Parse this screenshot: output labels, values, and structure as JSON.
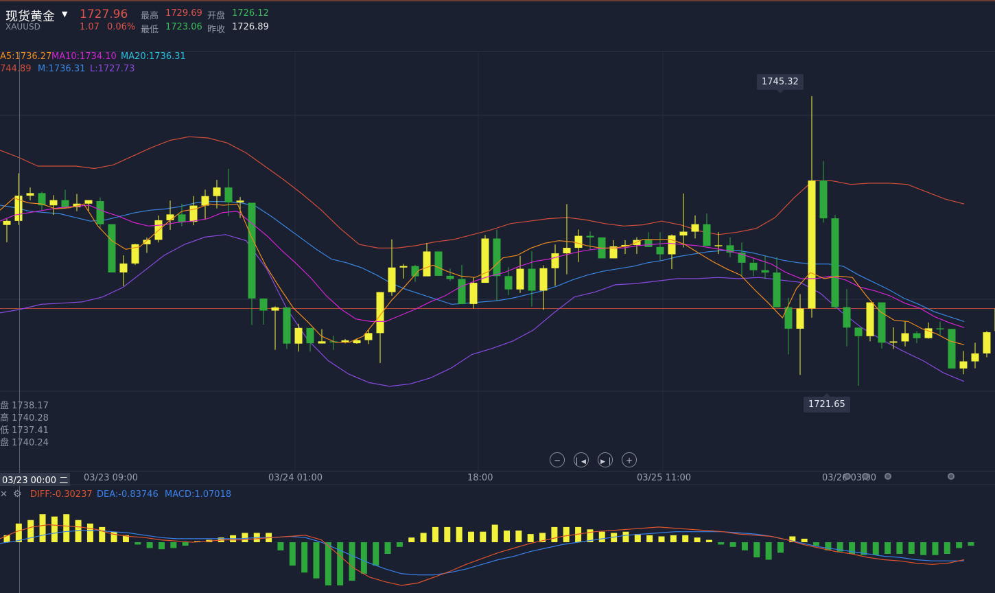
{
  "header": {
    "title": "现货黄金",
    "symbol": "XAUUSD",
    "price": "1727.96",
    "change": "1.07",
    "change_pct": "0.06%",
    "high_label": "最高",
    "high_value": "1729.69",
    "open_label": "开盘",
    "open_value": "1726.12",
    "low_label": "最低",
    "low_value": "1723.06",
    "prev_close_label": "昨收",
    "prev_close_value": "1726.89"
  },
  "ma_legend": {
    "ma5": "A5:1736.27",
    "ma10": "MA10:1734.10",
    "ma20": "MA20:1736.31"
  },
  "boll_legend": {
    "upper": "744.89",
    "mid": "M:1736.31",
    "lower": "L:1727.73"
  },
  "cursor_ohlc": [
    "盘 1738.17",
    "高 1740.28",
    "低 1737.41",
    "盘 1740.24"
  ],
  "markers": {
    "high": "1745.32",
    "low": "1721.65"
  },
  "time_axis": {
    "cursor_label": "03/23 00:00 二",
    "ticks": [
      "03/23 09:00",
      "03/24 01:00",
      "18:00",
      "03/25 11:00",
      "03/26 03:00"
    ]
  },
  "macd_legend": {
    "diff": "DIFF:-0.30237",
    "dea": "DEA:-0.83746",
    "macd": "MACD:1.07018"
  },
  "controls": [
    "zoom-out",
    "prev",
    "next",
    "zoom-in"
  ],
  "colors": {
    "bg": "#1a2030",
    "up_candle": "#f2f23c",
    "down_candle": "#2ea83c",
    "ma5": "#f08c1e",
    "ma10": "#d424d4",
    "ma20": "#2aa0e6",
    "boll_upper": "#d24e3a",
    "boll_mid": "#3a86e0",
    "boll_lower": "#8a4ae0",
    "diff": "#e0532c",
    "dea": "#3a80e8"
  },
  "chart_data": {
    "type": "candlestick",
    "ylim": [
      1719.5,
      1748.5
    ],
    "candles": [
      {
        "o": 1734.79,
        "h": 1735.27,
        "l": 1733.38,
        "c": 1735.12
      },
      {
        "o": 1735.12,
        "h": 1739.01,
        "l": 1734.79,
        "c": 1737.18
      },
      {
        "o": 1737.18,
        "h": 1737.85,
        "l": 1736.8,
        "c": 1737.39
      },
      {
        "o": 1737.39,
        "h": 1737.5,
        "l": 1735.96,
        "c": 1736.39
      },
      {
        "o": 1736.39,
        "h": 1737.22,
        "l": 1735.61,
        "c": 1736.82
      },
      {
        "o": 1736.82,
        "h": 1737.67,
        "l": 1736.14,
        "c": 1736.24
      },
      {
        "o": 1736.24,
        "h": 1737.33,
        "l": 1735.92,
        "c": 1736.53
      },
      {
        "o": 1736.53,
        "h": 1736.82,
        "l": 1735.92,
        "c": 1736.82
      },
      {
        "o": 1736.74,
        "h": 1737.04,
        "l": 1734.51,
        "c": 1734.85
      },
      {
        "o": 1734.85,
        "h": 1734.85,
        "l": 1730.91,
        "c": 1730.91
      },
      {
        "o": 1730.91,
        "h": 1732.31,
        "l": 1729.79,
        "c": 1731.64
      },
      {
        "o": 1731.64,
        "h": 1733.25,
        "l": 1731.53,
        "c": 1733.21
      },
      {
        "o": 1733.21,
        "h": 1733.76,
        "l": 1732.51,
        "c": 1733.57
      },
      {
        "o": 1733.57,
        "h": 1735.56,
        "l": 1733.36,
        "c": 1735.17
      },
      {
        "o": 1735.17,
        "h": 1736.78,
        "l": 1734.38,
        "c": 1735.65
      },
      {
        "o": 1735.65,
        "h": 1736.53,
        "l": 1734.69,
        "c": 1735.05
      },
      {
        "o": 1735.05,
        "h": 1737.15,
        "l": 1734.77,
        "c": 1736.37
      },
      {
        "o": 1736.37,
        "h": 1737.67,
        "l": 1735.22,
        "c": 1737.15
      },
      {
        "o": 1737.15,
        "h": 1738.47,
        "l": 1736.14,
        "c": 1737.85
      },
      {
        "o": 1737.85,
        "h": 1739.38,
        "l": 1735.51,
        "c": 1736.64
      },
      {
        "o": 1736.64,
        "h": 1737.07,
        "l": 1735.36,
        "c": 1736.78
      },
      {
        "o": 1736.6,
        "h": 1736.6,
        "l": 1726.61,
        "c": 1728.78
      },
      {
        "o": 1728.78,
        "h": 1728.78,
        "l": 1726.64,
        "c": 1727.79
      },
      {
        "o": 1727.79,
        "h": 1728.14,
        "l": 1724.58,
        "c": 1728.05
      },
      {
        "o": 1728.05,
        "h": 1728.05,
        "l": 1724.65,
        "c": 1725.09
      },
      {
        "o": 1725.09,
        "h": 1726.71,
        "l": 1724.44,
        "c": 1726.37
      },
      {
        "o": 1726.37,
        "h": 1726.37,
        "l": 1724.44,
        "c": 1725.12
      },
      {
        "o": 1725.1,
        "h": 1726.27,
        "l": 1725.1,
        "c": 1725.28
      },
      {
        "o": 1725.28,
        "h": 1725.73,
        "l": 1724.58,
        "c": 1725.21
      },
      {
        "o": 1725.21,
        "h": 1725.47,
        "l": 1725.11,
        "c": 1725.36
      },
      {
        "o": 1725.12,
        "h": 1725.53,
        "l": 1725.07,
        "c": 1725.38
      },
      {
        "o": 1725.38,
        "h": 1726.27,
        "l": 1725.06,
        "c": 1725.95
      },
      {
        "o": 1725.95,
        "h": 1728.43,
        "l": 1723.51,
        "c": 1729.3
      },
      {
        "o": 1729.3,
        "h": 1733.61,
        "l": 1729.0,
        "c": 1731.31
      },
      {
        "o": 1731.31,
        "h": 1731.6,
        "l": 1730.41,
        "c": 1731.43
      },
      {
        "o": 1731.43,
        "h": 1731.53,
        "l": 1730.14,
        "c": 1730.59
      },
      {
        "o": 1730.59,
        "h": 1733.31,
        "l": 1730.63,
        "c": 1732.62
      },
      {
        "o": 1732.62,
        "h": 1732.62,
        "l": 1730.64,
        "c": 1730.63
      },
      {
        "o": 1730.63,
        "h": 1731.21,
        "l": 1730.21,
        "c": 1730.37
      },
      {
        "o": 1730.37,
        "h": 1731.53,
        "l": 1728.98,
        "c": 1728.33
      },
      {
        "o": 1728.33,
        "h": 1730.5,
        "l": 1727.96,
        "c": 1730.06
      },
      {
        "o": 1730.06,
        "h": 1733.96,
        "l": 1730.06,
        "c": 1733.68
      },
      {
        "o": 1733.68,
        "h": 1734.41,
        "l": 1728.57,
        "c": 1730.61
      },
      {
        "o": 1730.61,
        "h": 1731.34,
        "l": 1729.06,
        "c": 1729.52
      },
      {
        "o": 1729.52,
        "h": 1732.26,
        "l": 1729.23,
        "c": 1731.21
      },
      {
        "o": 1731.21,
        "h": 1732.66,
        "l": 1728.13,
        "c": 1729.42
      },
      {
        "o": 1729.42,
        "h": 1731.49,
        "l": 1727.84,
        "c": 1731.25
      },
      {
        "o": 1731.25,
        "h": 1733.19,
        "l": 1729.82,
        "c": 1732.47
      },
      {
        "o": 1732.47,
        "h": 1736.49,
        "l": 1730.76,
        "c": 1732.92
      },
      {
        "o": 1732.92,
        "h": 1734.42,
        "l": 1731.76,
        "c": 1733.9
      },
      {
        "o": 1733.9,
        "h": 1734.26,
        "l": 1732.77,
        "c": 1733.77
      },
      {
        "o": 1733.77,
        "h": 1733.77,
        "l": 1732.06,
        "c": 1732.06
      },
      {
        "o": 1732.06,
        "h": 1733.55,
        "l": 1732.06,
        "c": 1733.04
      },
      {
        "o": 1733.04,
        "h": 1733.55,
        "l": 1732.41,
        "c": 1733.15
      },
      {
        "o": 1733.15,
        "h": 1733.78,
        "l": 1732.42,
        "c": 1733.56
      },
      {
        "o": 1733.56,
        "h": 1734.19,
        "l": 1732.99,
        "c": 1732.99
      },
      {
        "o": 1732.99,
        "h": 1734.19,
        "l": 1731.91,
        "c": 1732.39
      },
      {
        "o": 1732.39,
        "h": 1734.01,
        "l": 1731.18,
        "c": 1733.93
      },
      {
        "o": 1733.93,
        "h": 1737.36,
        "l": 1732.95,
        "c": 1734.24
      },
      {
        "o": 1734.24,
        "h": 1735.57,
        "l": 1733.69,
        "c": 1734.85
      },
      {
        "o": 1734.85,
        "h": 1735.72,
        "l": 1733.86,
        "c": 1733.07
      },
      {
        "o": 1733.07,
        "h": 1734.21,
        "l": 1732.41,
        "c": 1733.13
      },
      {
        "o": 1733.13,
        "h": 1733.77,
        "l": 1732.15,
        "c": 1732.53
      },
      {
        "o": 1732.53,
        "h": 1733.35,
        "l": 1730.6,
        "c": 1731.7
      },
      {
        "o": 1731.7,
        "h": 1732.08,
        "l": 1730.6,
        "c": 1731.09
      },
      {
        "o": 1731.09,
        "h": 1732.26,
        "l": 1730.36,
        "c": 1730.9
      },
      {
        "o": 1730.9,
        "h": 1732.15,
        "l": 1728.33,
        "c": 1728.06
      },
      {
        "o": 1728.06,
        "h": 1728.84,
        "l": 1724.21,
        "c": 1726.31
      },
      {
        "o": 1726.31,
        "h": 1729.14,
        "l": 1722.53,
        "c": 1727.96
      },
      {
        "o": 1727.96,
        "h": 1745.32,
        "l": 1727.22,
        "c": 1738.42
      },
      {
        "o": 1738.42,
        "h": 1740.01,
        "l": 1734.98,
        "c": 1735.33
      },
      {
        "o": 1735.33,
        "h": 1735.6,
        "l": 1727.96,
        "c": 1728.07
      },
      {
        "o": 1728.07,
        "h": 1729.54,
        "l": 1724.87,
        "c": 1726.4
      },
      {
        "o": 1726.4,
        "h": 1726.4,
        "l": 1721.65,
        "c": 1725.7
      },
      {
        "o": 1725.7,
        "h": 1728.42,
        "l": 1725.28,
        "c": 1728.46
      },
      {
        "o": 1728.46,
        "h": 1728.46,
        "l": 1724.69,
        "c": 1725.17
      },
      {
        "o": 1725.17,
        "h": 1726.42,
        "l": 1724.65,
        "c": 1725.27
      },
      {
        "o": 1725.27,
        "h": 1726.94,
        "l": 1724.87,
        "c": 1725.94
      },
      {
        "o": 1725.94,
        "h": 1726.11,
        "l": 1725.13,
        "c": 1725.54
      },
      {
        "o": 1725.54,
        "h": 1726.82,
        "l": 1725.49,
        "c": 1726.34
      },
      {
        "o": 1726.34,
        "h": 1726.89,
        "l": 1725.77,
        "c": 1726.29
      },
      {
        "o": 1726.29,
        "h": 1726.29,
        "l": 1723.06,
        "c": 1723.06
      },
      {
        "o": 1723.06,
        "h": 1724.48,
        "l": 1722.59,
        "c": 1723.64
      },
      {
        "o": 1723.64,
        "h": 1725.16,
        "l": 1723.07,
        "c": 1724.29
      },
      {
        "o": 1724.29,
        "h": 1726.12,
        "l": 1723.98,
        "c": 1726.02
      },
      {
        "o": 1726.12,
        "h": 1729.69,
        "l": 1725.45,
        "c": 1727.96
      }
    ],
    "ma5": [
      1736.0,
      1737.0,
      1736.6,
      1736.5,
      1736.1,
      1736.2,
      1736.5,
      1734.7,
      1733.5,
      1732.8,
      1733.0,
      1734.0,
      1735.0,
      1735.9,
      1736.1,
      1736.5,
      1736.4,
      1736.5,
      1733.8,
      1731.5,
      1729.7,
      1728.0,
      1726.9,
      1725.7,
      1725.2,
      1725.2,
      1725.7,
      1727.1,
      1728.6,
      1729.8,
      1731.1,
      1731.5,
      1731.0,
      1730.6,
      1730.5,
      1731.0,
      1732.1,
      1732.3,
      1732.9,
      1733.3,
      1733.5,
      1733.4,
      1733.1,
      1732.9,
      1732.9,
      1733.1,
      1733.6,
      1733.6,
      1733.6,
      1733.2,
      1732.5,
      1731.8,
      1731.2,
      1730.7,
      1729.5,
      1728.4,
      1727.2,
      1729.6,
      1730.9,
      1730.4,
      1730.6,
      1730.5,
      1729.0,
      1727.7,
      1727.0,
      1726.9,
      1726.3,
      1725.9,
      1725.3,
      1725.0
    ],
    "ma10": [
      1735.1,
      1735.6,
      1735.8,
      1736.0,
      1736.2,
      1736.3,
      1736.4,
      1735.9,
      1735.5,
      1735.0,
      1734.7,
      1734.8,
      1735.0,
      1735.1,
      1735.3,
      1735.8,
      1735.9,
      1734.9,
      1733.9,
      1732.7,
      1731.6,
      1730.4,
      1729.0,
      1727.9,
      1727.1,
      1726.9,
      1726.9,
      1727.4,
      1727.9,
      1728.5,
      1729.0,
      1729.7,
      1730.2,
      1730.6,
      1730.9,
      1731.4,
      1731.8,
      1732.0,
      1732.3,
      1732.6,
      1732.8,
      1732.9,
      1732.9,
      1733.1,
      1733.2,
      1733.3,
      1733.2,
      1733.1,
      1732.9,
      1732.7,
      1732.4,
      1732.0,
      1731.6,
      1730.9,
      1730.4,
      1730.4,
      1730.6,
      1730.3,
      1729.7,
      1729.4,
      1729.0,
      1728.4,
      1728.0,
      1727.3,
      1726.8,
      1726.4
    ],
    "boll_mid": [
      1736.4,
      1736.2,
      1735.9,
      1735.8,
      1735.7,
      1735.4,
      1735.1,
      1735.2,
      1735.5,
      1735.8,
      1736.0,
      1736.1,
      1736.3,
      1736.6,
      1736.7,
      1736.7,
      1736.6,
      1736.3,
      1735.5,
      1734.6,
      1733.7,
      1732.8,
      1732.0,
      1731.7,
      1731.3,
      1730.7,
      1730.0,
      1729.5,
      1729.1,
      1728.7,
      1728.3,
      1728.4,
      1728.5,
      1728.6,
      1728.8,
      1729.1,
      1729.4,
      1729.8,
      1730.3,
      1730.7,
      1731.0,
      1731.2,
      1731.4,
      1731.7,
      1731.9,
      1732.2,
      1732.4,
      1732.6,
      1732.7,
      1732.7,
      1732.5,
      1732.2,
      1731.9,
      1731.7,
      1731.6,
      1731.6,
      1731.4,
      1730.7,
      1730.1,
      1729.5,
      1728.8,
      1728.3,
      1727.7,
      1727.3,
      1726.9
    ],
    "boll_upper": [
      1740.9,
      1740.3,
      1739.6,
      1739.6,
      1739.6,
      1739.4,
      1739.7,
      1740.4,
      1741.1,
      1741.7,
      1742.0,
      1741.9,
      1741.5,
      1740.7,
      1739.6,
      1738.5,
      1737.3,
      1736.0,
      1734.5,
      1733.2,
      1732.9,
      1732.9,
      1733.1,
      1733.4,
      1733.6,
      1734.0,
      1734.4,
      1734.9,
      1735.1,
      1735.3,
      1735.4,
      1735.2,
      1734.9,
      1734.7,
      1734.8,
      1735.1,
      1734.8,
      1734.3,
      1734.0,
      1734.2,
      1734.5,
      1735.4,
      1737.0,
      1738.4,
      1738.4,
      1738.1,
      1738.2,
      1738.2,
      1738.1,
      1737.5,
      1736.9,
      1736.5
    ],
    "boll_lower": [
      1727.6,
      1727.9,
      1728.3,
      1728.4,
      1728.5,
      1728.9,
      1729.7,
      1731.0,
      1732.3,
      1733.2,
      1733.8,
      1734.0,
      1733.5,
      1731.2,
      1727.9,
      1725.4,
      1723.7,
      1722.6,
      1721.9,
      1721.6,
      1721.8,
      1722.3,
      1723.1,
      1724.2,
      1724.7,
      1725.3,
      1726.2,
      1727.6,
      1728.9,
      1729.3,
      1729.9,
      1730.0,
      1730.2,
      1730.4,
      1730.4,
      1730.5,
      1730.4,
      1730.5,
      1730.3,
      1730.1,
      1729.2,
      1727.7,
      1726.4,
      1725.4,
      1724.5,
      1723.7,
      1722.7,
      1722.0
    ],
    "macd_hist": [
      0.6,
      1.6,
      1.9,
      2.4,
      2.2,
      2.4,
      1.9,
      1.6,
      1.3,
      0.9,
      0.6,
      -0.2,
      -0.5,
      -0.6,
      -0.5,
      -0.3,
      0.1,
      0.2,
      0.4,
      0.6,
      0.8,
      0.8,
      0.8,
      -0.7,
      -2.0,
      -2.6,
      -3.1,
      -3.7,
      -3.7,
      -3.3,
      -2.7,
      -2.0,
      -1.0,
      -0.4,
      0.4,
      0.8,
      1.3,
      1.3,
      1.3,
      0.9,
      0.9,
      1.5,
      1.0,
      1.0,
      0.7,
      0.8,
      1.3,
      1.3,
      1.3,
      1.1,
      0.9,
      0.8,
      0.9,
      0.7,
      0.6,
      0.5,
      0.6,
      0.6,
      0.4,
      0.2,
      -0.2,
      -0.4,
      -0.7,
      -1.3,
      -1.5,
      -0.9,
      0.5,
      0.3,
      -0.3,
      -0.7,
      -0.8,
      -1.0,
      -1.1,
      -1.1,
      -1.0,
      -1.0,
      -1.0,
      -1.1,
      -1.1,
      -1.0,
      -0.5,
      -0.3
    ],
    "macd_diff": [
      0.3,
      0.9,
      1.3,
      1.5,
      1.4,
      1.3,
      1.1,
      0.7,
      0.5,
      0.4,
      0.2,
      0.1,
      0.0,
      0.1,
      0.2,
      0.2,
      0.3,
      0.4,
      0.5,
      0.6,
      0.2,
      -1.0,
      -2.2,
      -3.0,
      -3.4,
      -3.7,
      -3.5,
      -3.0,
      -2.5,
      -1.9,
      -1.4,
      -0.9,
      -0.5,
      -0.1,
      0.2,
      0.5,
      0.7,
      0.9,
      1.0,
      1.1,
      1.2,
      1.3,
      1.2,
      1.1,
      1.0,
      0.9,
      0.7,
      0.6,
      0.5,
      0.2,
      -0.2,
      -0.5,
      -0.8,
      -1.0,
      -1.3,
      -1.5,
      -1.6,
      -1.8,
      -1.9,
      -1.8,
      -1.5
    ],
    "macd_dea": [
      -0.1,
      0.1,
      0.4,
      0.7,
      0.9,
      1.0,
      1.0,
      0.9,
      0.8,
      0.6,
      0.4,
      0.3,
      0.3,
      0.3,
      0.3,
      0.3,
      0.4,
      0.4,
      0.5,
      0.4,
      0.0,
      -0.6,
      -1.2,
      -1.8,
      -2.3,
      -2.7,
      -2.8,
      -2.8,
      -2.6,
      -2.3,
      -1.9,
      -1.5,
      -1.2,
      -0.8,
      -0.5,
      -0.2,
      0.0,
      0.2,
      0.4,
      0.6,
      0.7,
      0.8,
      0.9,
      0.9,
      0.9,
      0.9,
      0.8,
      0.7,
      0.5,
      0.2,
      -0.1,
      -0.4,
      -0.6,
      -0.8,
      -1.0,
      -1.2,
      -1.3,
      -1.5,
      -1.6,
      -1.6,
      -1.6
    ]
  }
}
